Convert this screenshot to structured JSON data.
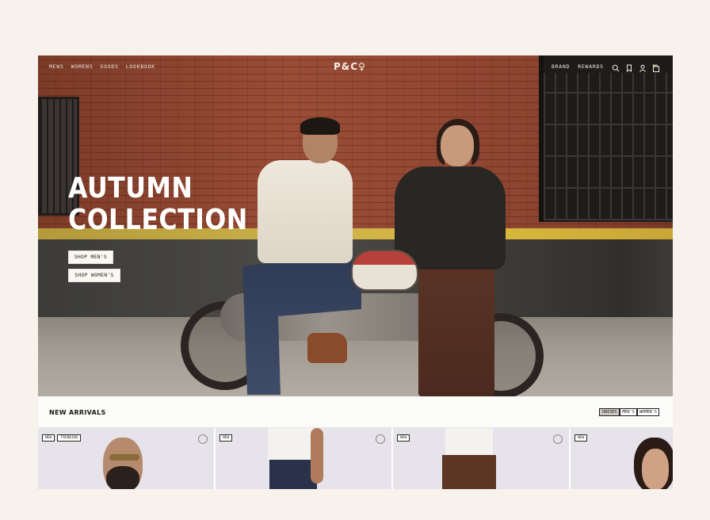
{
  "nav": {
    "left_links": [
      "MENS",
      "WOMENS",
      "GOODS",
      "LOOKBOOK"
    ],
    "logo": "P&C♀",
    "right_links": [
      "BRAND",
      "REWARDS"
    ],
    "icons": [
      "search-icon",
      "bookmark-icon",
      "account-icon",
      "bag-icon"
    ]
  },
  "hero": {
    "title_line1": "AUTUMN",
    "title_line2": "COLLECTION",
    "shop_mens": "SHOP MEN'S",
    "shop_womens": "SHOP WOMEN'S"
  },
  "arrivals": {
    "title": "NEW ARRIVALS",
    "filters": [
      "UNISEX",
      "MEN'S",
      "WOMEN'S"
    ],
    "selected_filter": "UNISEX",
    "products": [
      {
        "badges": [
          "NEW",
          "TRENDING"
        ]
      },
      {
        "badges": [
          "NEW"
        ]
      },
      {
        "badges": [
          "NEW"
        ]
      },
      {
        "badges": [
          "NEW"
        ]
      }
    ]
  },
  "colors": {
    "page_bg": "#f7f2ec",
    "brick": "#8f4530",
    "stripe": "#d8b93c",
    "product_bg": "#e6e3ea"
  }
}
